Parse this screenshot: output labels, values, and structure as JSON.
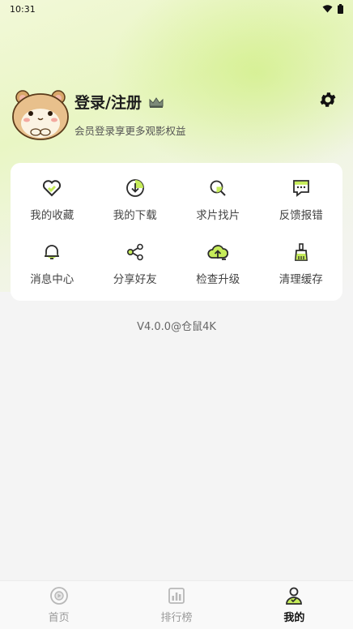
{
  "status_bar": {
    "time": "10:31",
    "icons": [
      "wifi-icon",
      "battery-icon"
    ]
  },
  "profile": {
    "title": "登录/注册",
    "subtitle": "会员登录享更多观影权益",
    "avatar_icon": "hamster-avatar",
    "crown_icon": "crown-icon",
    "settings_icon": "gear-icon"
  },
  "menu": {
    "items": [
      {
        "label": "我的收藏",
        "icon": "heart-icon"
      },
      {
        "label": "我的下载",
        "icon": "download-icon"
      },
      {
        "label": "求片找片",
        "icon": "search-film-icon"
      },
      {
        "label": "反馈报错",
        "icon": "feedback-icon"
      },
      {
        "label": "消息中心",
        "icon": "bell-icon"
      },
      {
        "label": "分享好友",
        "icon": "share-icon"
      },
      {
        "label": "检查升级",
        "icon": "upgrade-icon"
      },
      {
        "label": "清理缓存",
        "icon": "broom-icon"
      }
    ]
  },
  "version": "V4.0.0@仓鼠4K",
  "tabbar": {
    "tabs": [
      {
        "label": "首页",
        "icon": "home-icon",
        "active": false
      },
      {
        "label": "排行榜",
        "icon": "ranking-icon",
        "active": false
      },
      {
        "label": "我的",
        "icon": "profile-icon",
        "active": true
      }
    ]
  },
  "colors": {
    "accent": "#c6ec5a",
    "text_primary": "#1d1d1d",
    "text_secondary": "#555555"
  }
}
